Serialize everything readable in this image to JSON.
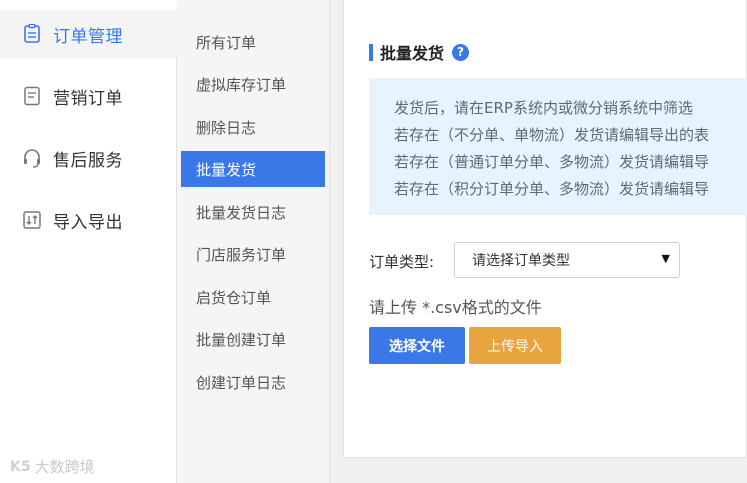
{
  "nav1": {
    "items": [
      {
        "label": "订单管理",
        "icon": "document-list-icon",
        "active": true
      },
      {
        "label": "营销订单",
        "icon": "document-icon",
        "active": false
      },
      {
        "label": "售后服务",
        "icon": "headset-icon",
        "active": false
      },
      {
        "label": "导入导出",
        "icon": "import-export-icon",
        "active": false
      }
    ]
  },
  "nav2": {
    "items": [
      {
        "label": "所有订单"
      },
      {
        "label": "虚拟库存订单"
      },
      {
        "label": "删除日志"
      },
      {
        "label": "批量发货",
        "active": true
      },
      {
        "label": "批量发货日志"
      },
      {
        "label": "门店服务订单"
      },
      {
        "label": "启货仓订单"
      },
      {
        "label": "批量创建订单"
      },
      {
        "label": "创建订单日志"
      }
    ]
  },
  "main": {
    "title": "批量发货",
    "help_icon": "?",
    "info_lines": [
      "发货后，请在ERP系统内或微分销系统中筛选",
      "若存在（不分单、单物流）发货请编辑导出的表",
      "若存在（普通订单分单、多物流）发货请编辑导",
      "若存在（积分订单分单、多物流）发货请编辑导"
    ],
    "order_type_label": "订单类型:",
    "order_type_select": "请选择订单类型",
    "upload_hint": "请上传 *.csv格式的文件",
    "choose_file_button": "选择文件",
    "upload_button": "上传导入"
  },
  "watermark": {
    "logo": "K5",
    "text": "大数跨境"
  },
  "colors": {
    "accent": "#3b78e7",
    "upload": "#e8a43e",
    "info_bg": "#e8f4fd"
  }
}
